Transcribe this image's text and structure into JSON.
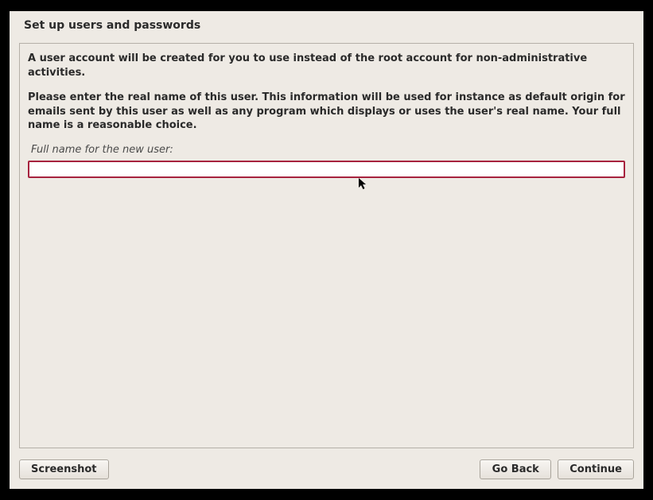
{
  "header": {
    "title": "Set up users and passwords"
  },
  "content": {
    "para1": "A user account will be created for you to use instead of the root account for non-administrative activities.",
    "para2": "Please enter the real name of this user. This information will be used for instance as default origin for emails sent by this user as well as any program which displays or uses the user's real name. Your full name is a reasonable choice.",
    "field_label": "Full name for the new user:",
    "field_value": ""
  },
  "buttons": {
    "screenshot": "Screenshot",
    "go_back": "Go Back",
    "continue": "Continue"
  }
}
